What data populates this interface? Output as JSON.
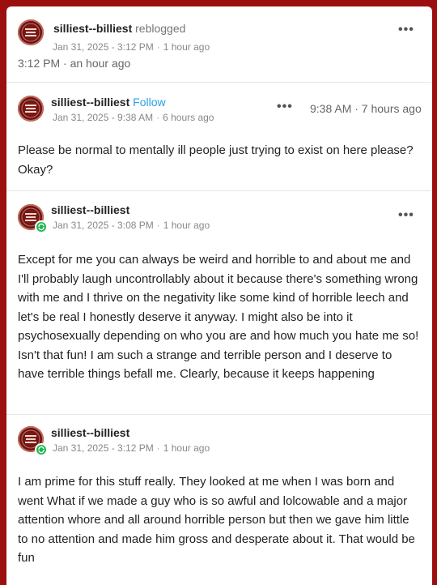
{
  "reblog": {
    "username": "silliest--billiest",
    "action": "reblogged",
    "date": "Jan 31, 2025 - 3:12 PM",
    "ago": "1 hour ago",
    "timestamp": "3:12 PM · an hour ago"
  },
  "posts": [
    {
      "username": "silliest--billiest",
      "follow_label": "Follow",
      "date": "Jan 31, 2025 - 9:38 AM",
      "ago": "6 hours ago",
      "timestamp": "9:38 AM · 7 hours ago",
      "text": "Please be normal to mentally ill people just trying to exist on here please? Okay?"
    },
    {
      "username": "silliest--billiest",
      "date": "Jan 31, 2025 - 3:08 PM",
      "ago": "1 hour ago",
      "text": "Except for me you can always be weird and horrible to and about me and I'll probably laugh uncontrollably about it because there's something wrong with me and I thrive on the negativity like some kind of horrible leech and let's be real I honestly deserve it anyway. I might also be into it psychosexually depending on who you are and how much you hate me so! Isn't that fun! I am such a strange and terrible person and I deserve to have terrible things befall me. Clearly, because it keeps happening"
    },
    {
      "username": "silliest--billiest",
      "date": "Jan 31, 2025 - 3:12 PM",
      "ago": "1 hour ago",
      "text": "I am prime for this stuff really. They looked at me when I was born and went What if we made a guy who is so awful and lolcowable and a major attention whore and all around horrible person but then we gave him little to no attention and made him gross and desperate about it. That would be fun"
    }
  ],
  "more_glyph": "•••",
  "colors": {
    "background": "#9b0f0f",
    "follow": "#2aa0e8",
    "badge": "#1fb853"
  }
}
